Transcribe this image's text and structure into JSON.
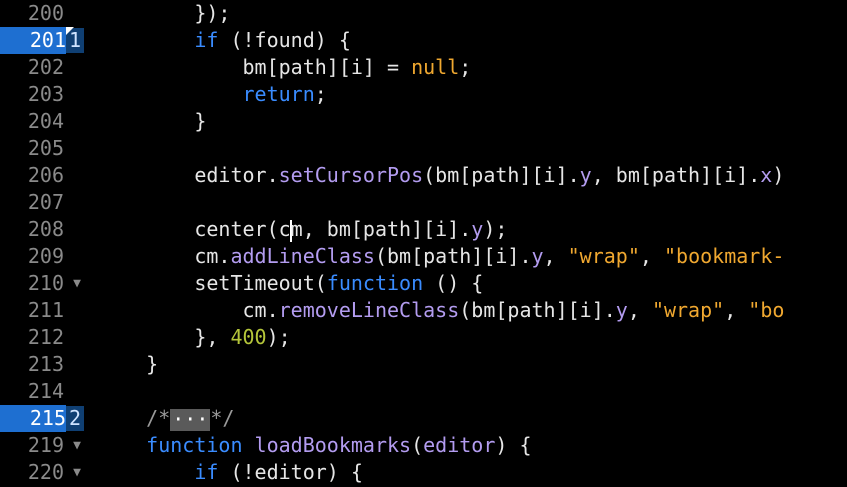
{
  "editor": {
    "lines": [
      {
        "num": "200",
        "bookmark": "",
        "fold": false,
        "indent": "        ",
        "segments": [
          {
            "t": "plain",
            "v": "});"
          }
        ]
      },
      {
        "num": "201",
        "bookmark": "1",
        "fold": false,
        "indent": "        ",
        "segments": [
          {
            "t": "kw",
            "v": "if"
          },
          {
            "t": "plain",
            "v": " (!found) {"
          }
        ]
      },
      {
        "num": "202",
        "bookmark": "",
        "fold": false,
        "indent": "            ",
        "segments": [
          {
            "t": "plain",
            "v": "bm[path][i] = "
          },
          {
            "t": "nl",
            "v": "null"
          },
          {
            "t": "plain",
            "v": ";"
          }
        ]
      },
      {
        "num": "203",
        "bookmark": "",
        "fold": false,
        "indent": "            ",
        "segments": [
          {
            "t": "kw",
            "v": "return"
          },
          {
            "t": "plain",
            "v": ";"
          }
        ]
      },
      {
        "num": "204",
        "bookmark": "",
        "fold": false,
        "indent": "        ",
        "segments": [
          {
            "t": "plain",
            "v": "}"
          }
        ]
      },
      {
        "num": "205",
        "bookmark": "",
        "fold": false,
        "indent": "",
        "segments": []
      },
      {
        "num": "206",
        "bookmark": "",
        "fold": false,
        "indent": "        ",
        "segments": [
          {
            "t": "plain",
            "v": "editor."
          },
          {
            "t": "fn",
            "v": "setCursorPos"
          },
          {
            "t": "plain",
            "v": "(bm[path][i]."
          },
          {
            "t": "fn",
            "v": "y"
          },
          {
            "t": "plain",
            "v": ", bm[path][i]."
          },
          {
            "t": "fn",
            "v": "x"
          },
          {
            "t": "plain",
            "v": ")"
          }
        ]
      },
      {
        "num": "207",
        "bookmark": "",
        "fold": false,
        "indent": "",
        "segments": []
      },
      {
        "num": "208",
        "bookmark": "",
        "fold": false,
        "indent": "        ",
        "caret": true,
        "segments": [
          {
            "t": "plain",
            "v": "center(c"
          },
          {
            "t": "caret",
            "v": ""
          },
          {
            "t": "plain",
            "v": "m, bm[path][i]."
          },
          {
            "t": "fn",
            "v": "y"
          },
          {
            "t": "plain",
            "v": ");"
          }
        ]
      },
      {
        "num": "209",
        "bookmark": "",
        "fold": false,
        "indent": "        ",
        "segments": [
          {
            "t": "plain",
            "v": "cm."
          },
          {
            "t": "fn",
            "v": "addLineClass"
          },
          {
            "t": "plain",
            "v": "(bm[path][i]."
          },
          {
            "t": "fn",
            "v": "y"
          },
          {
            "t": "plain",
            "v": ", "
          },
          {
            "t": "str",
            "v": "\"wrap\""
          },
          {
            "t": "plain",
            "v": ", "
          },
          {
            "t": "str",
            "v": "\"bookmark-"
          }
        ]
      },
      {
        "num": "210",
        "bookmark": "",
        "fold": true,
        "indent": "        ",
        "segments": [
          {
            "t": "plain",
            "v": "setTimeout("
          },
          {
            "t": "kw",
            "v": "function"
          },
          {
            "t": "plain",
            "v": " () {"
          }
        ]
      },
      {
        "num": "211",
        "bookmark": "",
        "fold": false,
        "indent": "            ",
        "segments": [
          {
            "t": "plain",
            "v": "cm."
          },
          {
            "t": "fn",
            "v": "removeLineClass"
          },
          {
            "t": "plain",
            "v": "(bm[path][i]."
          },
          {
            "t": "fn",
            "v": "y"
          },
          {
            "t": "plain",
            "v": ", "
          },
          {
            "t": "str",
            "v": "\"wrap\""
          },
          {
            "t": "plain",
            "v": ", "
          },
          {
            "t": "str",
            "v": "\"bo"
          }
        ]
      },
      {
        "num": "212",
        "bookmark": "",
        "fold": false,
        "indent": "        ",
        "segments": [
          {
            "t": "plain",
            "v": "}, "
          },
          {
            "t": "num",
            "v": "400"
          },
          {
            "t": "plain",
            "v": ");"
          }
        ]
      },
      {
        "num": "213",
        "bookmark": "",
        "fold": false,
        "indent": "    ",
        "segments": [
          {
            "t": "plain",
            "v": "}"
          }
        ]
      },
      {
        "num": "214",
        "bookmark": "",
        "fold": false,
        "indent": "",
        "segments": []
      },
      {
        "num": "215",
        "bookmark": "2",
        "fold": false,
        "indent": "    ",
        "segments": [
          {
            "t": "cm",
            "v": "/*"
          },
          {
            "t": "ell",
            "v": "···"
          },
          {
            "t": "cm",
            "v": "*/"
          }
        ]
      },
      {
        "num": "219",
        "bookmark": "",
        "fold": true,
        "indent": "    ",
        "segments": [
          {
            "t": "kw",
            "v": "function"
          },
          {
            "t": "plain",
            "v": " "
          },
          {
            "t": "fn",
            "v": "loadBookmarks"
          },
          {
            "t": "plain",
            "v": "("
          },
          {
            "t": "fn",
            "v": "editor"
          },
          {
            "t": "plain",
            "v": ") {"
          }
        ]
      },
      {
        "num": "220",
        "bookmark": "",
        "fold": true,
        "indent": "        ",
        "segments": [
          {
            "t": "kw",
            "v": "if"
          },
          {
            "t": "plain",
            "v": " (!editor) {"
          }
        ]
      }
    ],
    "fold_glyph": "▼"
  }
}
